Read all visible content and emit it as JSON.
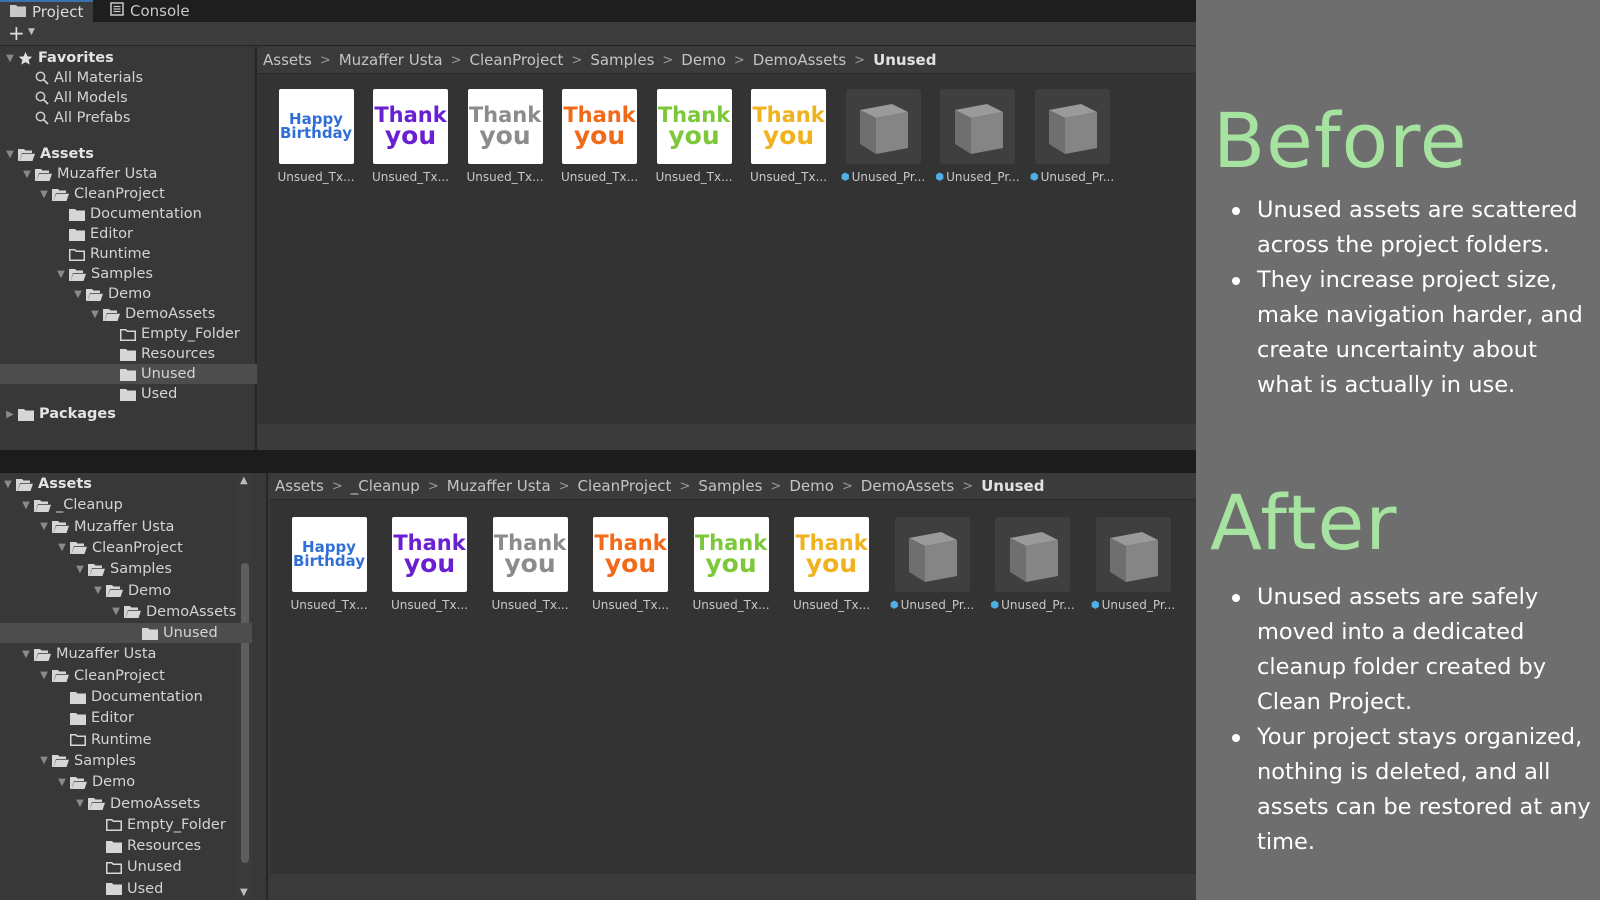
{
  "before": {
    "tabs": [
      {
        "label": "Project",
        "icon": "folder-icon"
      },
      {
        "label": "Console",
        "icon": "console-icon"
      }
    ],
    "toolbar": {
      "add_label": "+"
    },
    "tree": [
      {
        "label": "Favorites",
        "depth": 0,
        "icon": "star-icon",
        "expanded": true,
        "bold": true
      },
      {
        "label": "All Materials",
        "depth": 1,
        "icon": "search-icon"
      },
      {
        "label": "All Models",
        "depth": 1,
        "icon": "search-icon"
      },
      {
        "label": "All Prefabs",
        "depth": 1,
        "icon": "search-icon"
      },
      {
        "label": "Assets",
        "depth": 0,
        "icon": "folder-open-icon",
        "expanded": true,
        "bold": true
      },
      {
        "label": "Muzaffer Usta",
        "depth": 1,
        "icon": "folder-open-icon",
        "expanded": true
      },
      {
        "label": "CleanProject",
        "depth": 2,
        "icon": "folder-open-icon",
        "expanded": true
      },
      {
        "label": "Documentation",
        "depth": 3,
        "icon": "folder-icon"
      },
      {
        "label": "Editor",
        "depth": 3,
        "icon": "folder-icon"
      },
      {
        "label": "Runtime",
        "depth": 3,
        "icon": "folder-empty-icon"
      },
      {
        "label": "Samples",
        "depth": 3,
        "icon": "folder-open-icon",
        "expanded": true
      },
      {
        "label": "Demo",
        "depth": 4,
        "icon": "folder-open-icon",
        "expanded": true
      },
      {
        "label": "DemoAssets",
        "depth": 5,
        "icon": "folder-open-icon",
        "expanded": true
      },
      {
        "label": "Empty_Folder",
        "depth": 6,
        "icon": "folder-empty-icon"
      },
      {
        "label": "Resources",
        "depth": 6,
        "icon": "folder-icon"
      },
      {
        "label": "Unused",
        "depth": 6,
        "icon": "folder-icon",
        "selected": true
      },
      {
        "label": "Used",
        "depth": 6,
        "icon": "folder-icon"
      },
      {
        "label": "Packages",
        "depth": 0,
        "icon": "folder-icon",
        "collapsed": true,
        "bold": true
      }
    ],
    "breadcrumb": [
      "Assets",
      "Muzaffer Usta",
      "CleanProject",
      "Samples",
      "Demo",
      "DemoAssets",
      "Unused"
    ],
    "assets": [
      {
        "label": "Unsued_Tx...",
        "kind": "texture",
        "art": [
          "Happy",
          "Birthday"
        ],
        "color": "#2f6fd6"
      },
      {
        "label": "Unsued_Tx...",
        "kind": "texture",
        "art": [
          "Thank",
          "you"
        ],
        "color": "#6a1fd0"
      },
      {
        "label": "Unsued_Tx...",
        "kind": "texture",
        "art": [
          "Thank",
          "you"
        ],
        "color": "#8c8c8c"
      },
      {
        "label": "Unsued_Tx...",
        "kind": "texture",
        "art": [
          "Thank",
          "you"
        ],
        "color": "#f06a1a"
      },
      {
        "label": "Unsued_Tx...",
        "kind": "texture",
        "art": [
          "Thank",
          "you"
        ],
        "color": "#7cc83a"
      },
      {
        "label": "Unsued_Tx...",
        "kind": "texture",
        "art": [
          "Thank",
          "you"
        ],
        "color": "#f0b21e"
      },
      {
        "label": "Unused_Pr...",
        "kind": "prefab"
      },
      {
        "label": "Unused_Pr...",
        "kind": "prefab"
      },
      {
        "label": "Unused_Pr...",
        "kind": "prefab"
      }
    ]
  },
  "after": {
    "tree": [
      {
        "label": "Assets",
        "depth": 0,
        "icon": "folder-open-icon",
        "expanded": true,
        "bold": true
      },
      {
        "label": "_Cleanup",
        "depth": 1,
        "icon": "folder-open-icon",
        "expanded": true
      },
      {
        "label": "Muzaffer Usta",
        "depth": 2,
        "icon": "folder-open-icon",
        "expanded": true
      },
      {
        "label": "CleanProject",
        "depth": 3,
        "icon": "folder-open-icon",
        "expanded": true
      },
      {
        "label": "Samples",
        "depth": 4,
        "icon": "folder-open-icon",
        "expanded": true
      },
      {
        "label": "Demo",
        "depth": 5,
        "icon": "folder-open-icon",
        "expanded": true
      },
      {
        "label": "DemoAssets",
        "depth": 6,
        "icon": "folder-open-icon",
        "expanded": true
      },
      {
        "label": "Unused",
        "depth": 7,
        "icon": "folder-icon",
        "selected": true
      },
      {
        "label": "Muzaffer Usta",
        "depth": 1,
        "icon": "folder-open-icon",
        "expanded": true
      },
      {
        "label": "CleanProject",
        "depth": 2,
        "icon": "folder-open-icon",
        "expanded": true
      },
      {
        "label": "Documentation",
        "depth": 3,
        "icon": "folder-icon"
      },
      {
        "label": "Editor",
        "depth": 3,
        "icon": "folder-icon"
      },
      {
        "label": "Runtime",
        "depth": 3,
        "icon": "folder-empty-icon"
      },
      {
        "label": "Samples",
        "depth": 2,
        "icon": "folder-open-icon",
        "expanded": true
      },
      {
        "label": "Demo",
        "depth": 3,
        "icon": "folder-open-icon",
        "expanded": true
      },
      {
        "label": "DemoAssets",
        "depth": 4,
        "icon": "folder-open-icon",
        "expanded": true
      },
      {
        "label": "Empty_Folder",
        "depth": 5,
        "icon": "folder-empty-icon"
      },
      {
        "label": "Resources",
        "depth": 5,
        "icon": "folder-icon"
      },
      {
        "label": "Unused",
        "depth": 5,
        "icon": "folder-empty-icon"
      },
      {
        "label": "Used",
        "depth": 5,
        "icon": "folder-icon"
      }
    ],
    "breadcrumb": [
      "Assets",
      "_Cleanup",
      "Muzaffer Usta",
      "CleanProject",
      "Samples",
      "Demo",
      "DemoAssets",
      "Unused"
    ],
    "assets": [
      {
        "label": "Unsued_Tx...",
        "kind": "texture",
        "art": [
          "Happy",
          "Birthday"
        ],
        "color": "#2f6fd6"
      },
      {
        "label": "Unsued_Tx...",
        "kind": "texture",
        "art": [
          "Thank",
          "you"
        ],
        "color": "#6a1fd0"
      },
      {
        "label": "Unsued_Tx...",
        "kind": "texture",
        "art": [
          "Thank",
          "you"
        ],
        "color": "#8c8c8c"
      },
      {
        "label": "Unsued_Tx...",
        "kind": "texture",
        "art": [
          "Thank",
          "you"
        ],
        "color": "#f06a1a"
      },
      {
        "label": "Unsued_Tx...",
        "kind": "texture",
        "art": [
          "Thank",
          "you"
        ],
        "color": "#7cc83a"
      },
      {
        "label": "Unsued_Tx...",
        "kind": "texture",
        "art": [
          "Thank",
          "you"
        ],
        "color": "#f0b21e"
      },
      {
        "label": "Unused_Pr...",
        "kind": "prefab"
      },
      {
        "label": "Unused_Pr...",
        "kind": "prefab"
      },
      {
        "label": "Unused_Pr...",
        "kind": "prefab"
      }
    ]
  },
  "explain": {
    "before_title": "Before",
    "before_points": [
      "Unused assets are scattered across the project folders.",
      "They increase project size, make navigation harder, and create uncertainty about what is actually in use."
    ],
    "after_title": "After",
    "after_points": [
      "Unused assets are safely moved into a dedicated cleanup folder created by Clean Project.",
      "Your project stays organized, nothing is deleted, and all assets can be restored at any time."
    ]
  },
  "colors": {
    "headline": "#a6e3a1",
    "prefab_icon": "#4fb0e8",
    "editor_bg": "#383838"
  }
}
